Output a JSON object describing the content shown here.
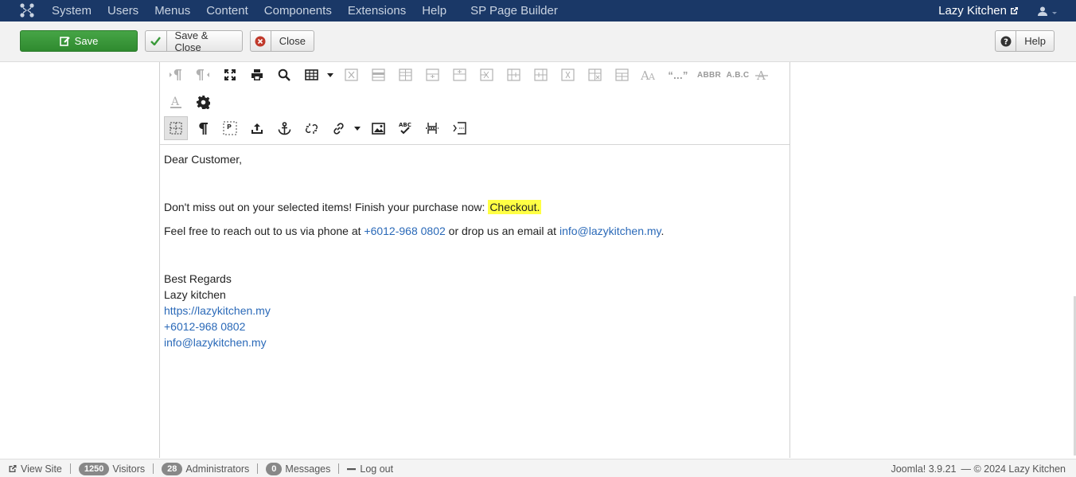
{
  "navbar": {
    "menu": [
      "System",
      "Users",
      "Menus",
      "Content",
      "Components",
      "Extensions",
      "Help",
      "SP Page Builder"
    ],
    "site_name": "Lazy Kitchen"
  },
  "toolbar": {
    "save_label": "Save",
    "save_close_label": "Save & Close",
    "close_label": "Close",
    "help_label": "Help"
  },
  "editor_toolbar": {
    "abbr": "ABBR",
    "abc": "A.B.C",
    "quote": "“...”",
    "spell": "ABC"
  },
  "content": {
    "greeting": "Dear Customer,",
    "line1_text": "Don't miss out on your selected items! Finish your purchase now: ",
    "line1_link": "Checkout.",
    "line2_pre": "Feel free to reach out to us via phone at ",
    "line2_phone": "+6012-968 0802",
    "line2_mid": " or drop us an email at ",
    "line2_email": "info@lazykitchen.my",
    "line2_post": ".",
    "regards": "Best Regards",
    "company": "Lazy kitchen",
    "website": "https://lazykitchen.my",
    "phone": "+6012-968 0802",
    "email": "info@lazykitchen.my"
  },
  "status": {
    "view_site": "View Site",
    "visitors_count": "1250",
    "visitors_label": "Visitors",
    "admins_count": "28",
    "admins_label": "Administrators",
    "messages_count": "0",
    "messages_label": "Messages",
    "logout": "Log out",
    "version": "Joomla! 3.9.21",
    "copyright": "— © 2024 Lazy Kitchen"
  },
  "colors": {
    "navbar": "#1a3867",
    "save_green": "#3a9a3a",
    "link": "#2a69b8",
    "highlight": "#ffff44"
  }
}
